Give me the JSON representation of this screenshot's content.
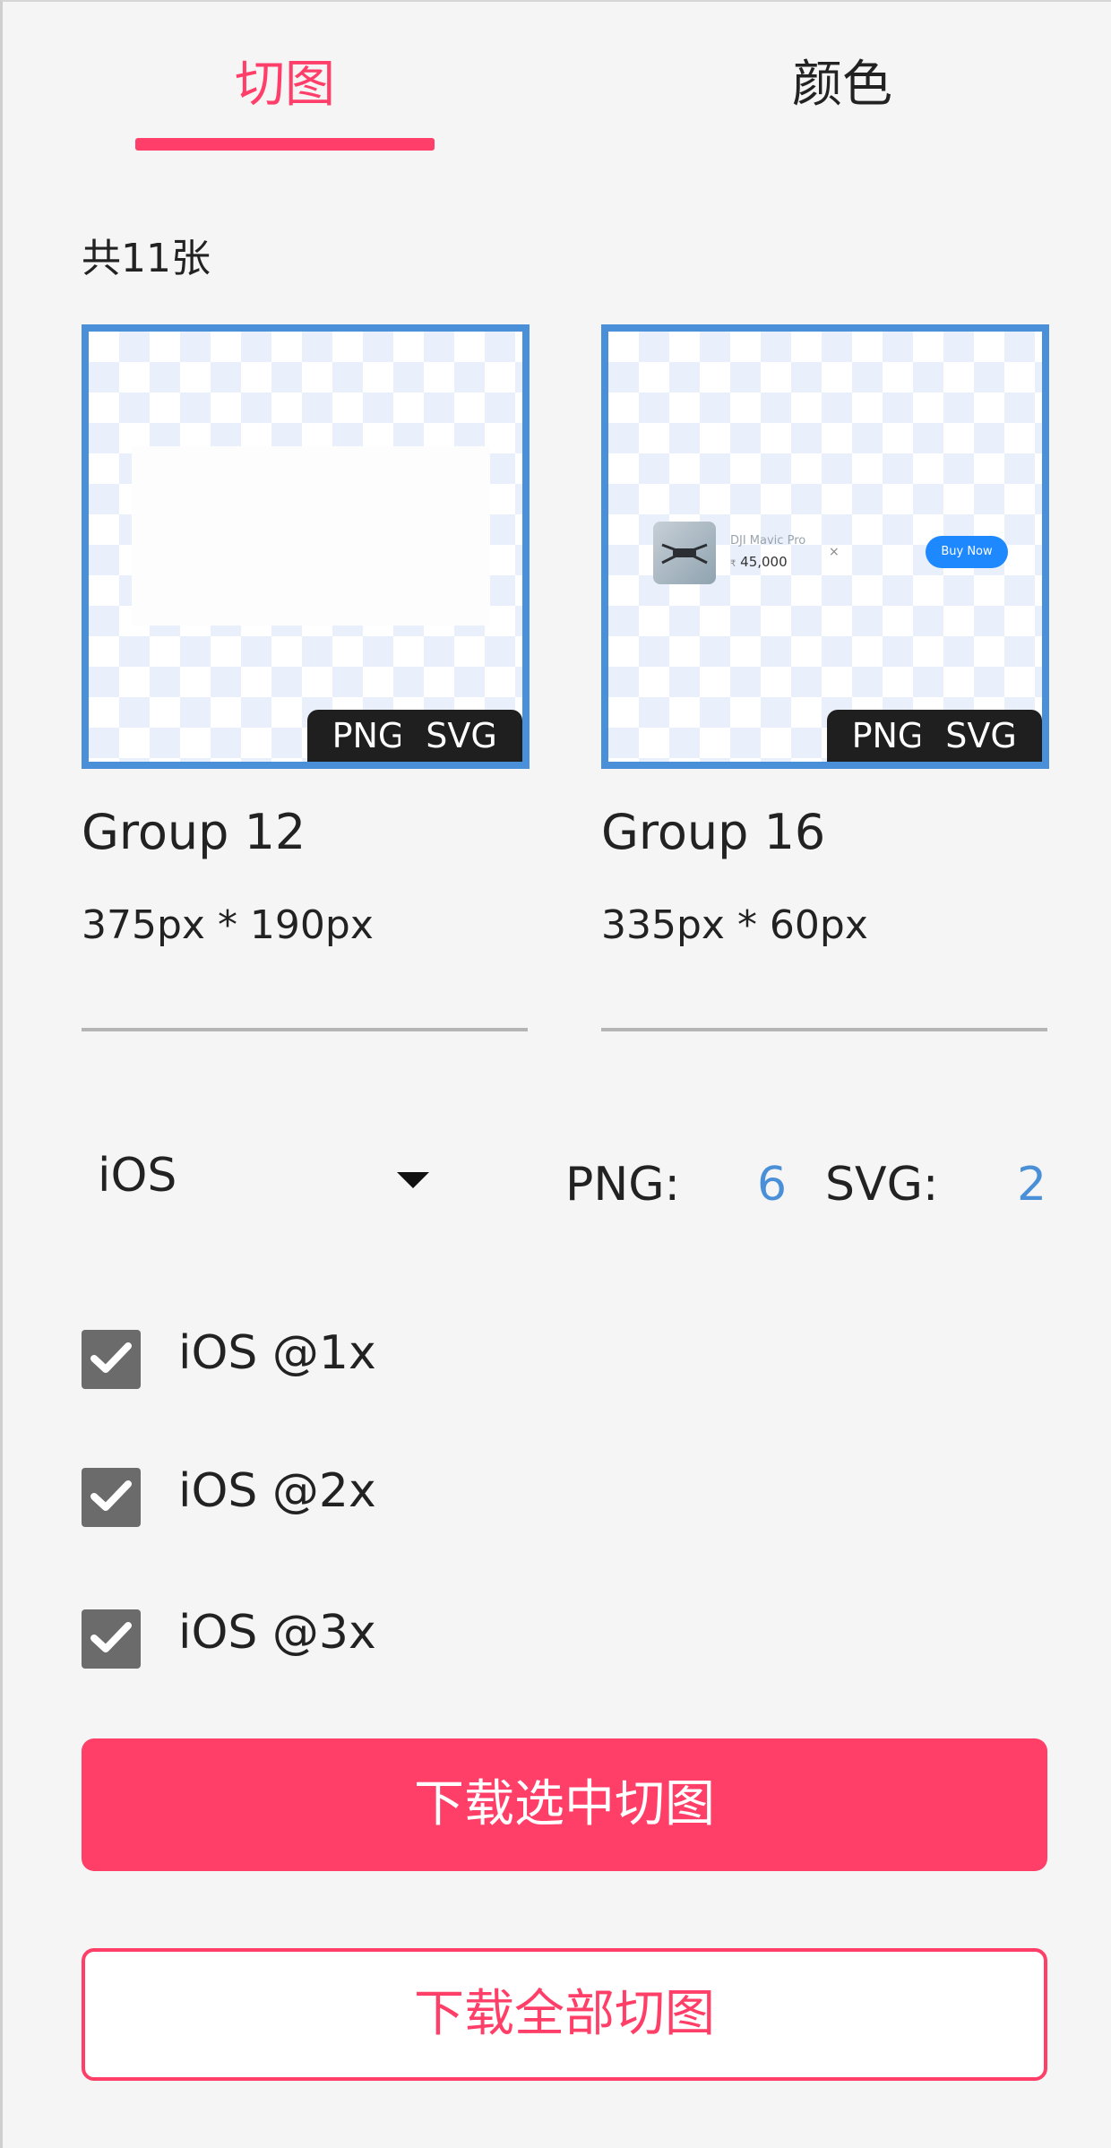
{
  "tabs": [
    {
      "label": "切图",
      "active": true
    },
    {
      "label": "颜色",
      "active": false
    }
  ],
  "colors": {
    "accent": "#ff3f6a",
    "blue": "#4a90d9",
    "badge": "#1f1f1f"
  },
  "summary": {
    "count_label": "共11张"
  },
  "assets": [
    {
      "name": "Group 12",
      "size": "375px * 190px",
      "formats": [
        "PNG",
        "SVG"
      ]
    },
    {
      "name": "Group 16",
      "size": "335px * 60px",
      "formats": [
        "PNG",
        "SVG"
      ],
      "preview": {
        "product_name": "DJI Mavic Pro",
        "price": "45,000",
        "button_label": "Buy Now"
      }
    }
  ],
  "platform": {
    "selected": "iOS"
  },
  "stats": {
    "png_label": "PNG:",
    "png_count": "6",
    "svg_label": "SVG:",
    "svg_count": "2"
  },
  "scales": [
    {
      "label": "iOS @1x",
      "checked": true
    },
    {
      "label": "iOS @2x",
      "checked": true
    },
    {
      "label": "iOS @3x",
      "checked": true
    }
  ],
  "actions": {
    "download_selected": "下载选中切图",
    "download_all": "下载全部切图"
  }
}
